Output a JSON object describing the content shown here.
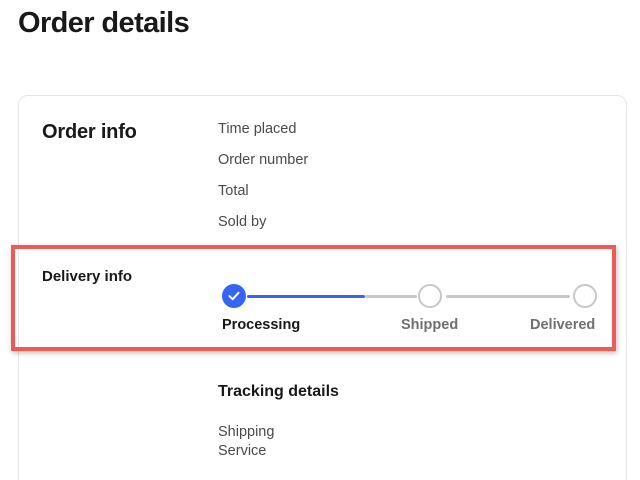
{
  "page": {
    "title": "Order details"
  },
  "order_info": {
    "title": "Order info",
    "fields": [
      "Time placed",
      "Order number",
      "Total",
      "Sold by"
    ]
  },
  "delivery_info": {
    "title": "Delivery info",
    "steps": [
      {
        "label": "Processing",
        "status": "complete"
      },
      {
        "label": "Shipped",
        "status": "pending"
      },
      {
        "label": "Delivered",
        "status": "pending"
      }
    ],
    "progress_fraction": 0.35
  },
  "tracking": {
    "title": "Tracking details",
    "fields": [
      "Shipping",
      "Service"
    ]
  },
  "colors": {
    "accent": "#3665f3",
    "inactive": "#c7c7c7",
    "highlight_border": "#ef5a55",
    "text_primary": "#191919",
    "text_secondary": "#707070"
  },
  "icons": {
    "complete_step": "checkmark-icon"
  }
}
